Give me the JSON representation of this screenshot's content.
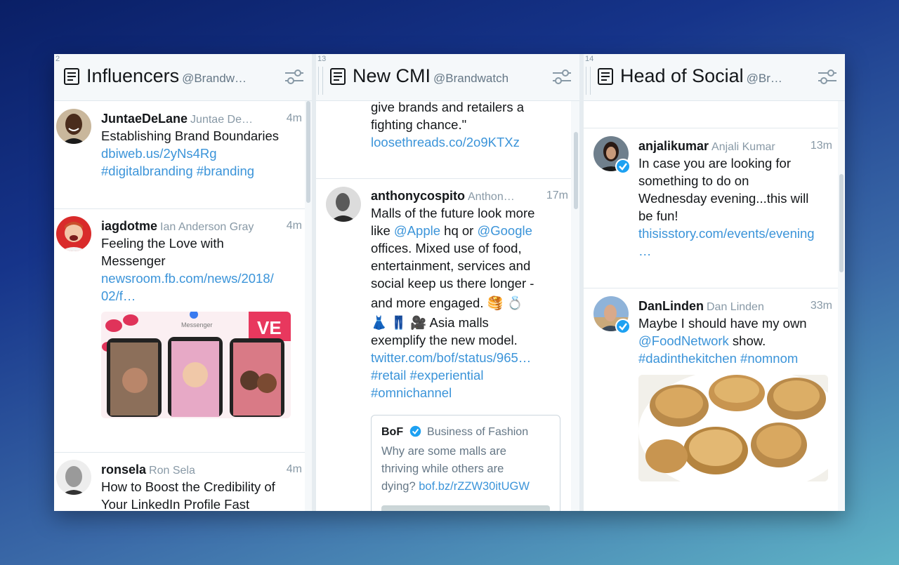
{
  "columns": [
    {
      "number": "2",
      "title": "Influencers",
      "subtitle": "@Brandw…",
      "tweets": [
        {
          "handle": "JuntaeDeLane",
          "fullname": "Juntae De…",
          "time": "4m",
          "text": "Establishing Brand Boundaries",
          "link": "dbiweb.us/2yNs4Rg",
          "tags": "#digitalbranding #branding"
        },
        {
          "handle": "iagdotme",
          "fullname": "Ian Anderson Gray",
          "time": "4m",
          "text_line1": "Feeling the Love with",
          "text_line2": "Messenger",
          "link_line1": "newsroom.fb.com/news/2018/",
          "link_line2": "02/f…",
          "media_caption": "Messenger",
          "media_badge": "VE"
        },
        {
          "handle": "ronsela",
          "fullname": "Ron Sela",
          "time": "4m",
          "text_line1": "How to Boost the Credibility of",
          "text_line2": "Your LinkedIn Profile Fast"
        }
      ]
    },
    {
      "number": "13",
      "title": "New CMI",
      "subtitle": "@Brandwatch",
      "partial": {
        "line1": "give brands and retailers a",
        "line2": "fighting chance.\"",
        "link": "loosethreads.co/2o9KTXz"
      },
      "tweets": [
        {
          "handle": "anthonycospito",
          "fullname": "Anthon…",
          "time": "17m",
          "l1": "Malls of the future look more",
          "l2_pre": "like ",
          "l2_m1": "@Apple",
          "l2_mid": " hq or ",
          "l2_m2": "@Google",
          "l3": "offices. Mixed use of food,",
          "l4": "entertainment, services and",
          "l5": "social keep us there longer -",
          "l6": "and more engaged. 🥞 💍",
          "l7": "👗 👖 🎥 Asia malls",
          "l8": "exemplify the new model.",
          "link": "twitter.com/bof/status/965…",
          "tags1": "#retail #experiential",
          "tags2": "#omnichannel",
          "quote": {
            "handle": "BoF",
            "fullname": "Business of Fashion",
            "line1": "Why are some malls are",
            "line2": "thriving while others are",
            "line3_pre": "dying? ",
            "line3_link": "bof.bz/rZZW30itUGW"
          }
        }
      ]
    },
    {
      "number": "14",
      "title": "Head of Social",
      "subtitle": "@Br…",
      "tweets": [
        {
          "handle": "anjalikumar",
          "fullname": "Anjali Kumar",
          "time": "13m",
          "l1": "In case you are looking for",
          "l2": "something to do on",
          "l3": "Wednesday evening...this will",
          "l4": "be fun!",
          "link1": "thisisstory.com/events/evening",
          "link2": "…"
        },
        {
          "handle": "DanLinden",
          "fullname": "Dan Linden",
          "time": "33m",
          "l1": "Maybe I should have my own",
          "mention": "@FoodNetwork",
          "l2_post": " show.",
          "tags": "#dadinthekitchen #nomnom"
        }
      ]
    }
  ],
  "colors": {
    "link": "#3b94d9",
    "verified": "#1da1f2",
    "header_bg": "#f5f8fa"
  },
  "icons": {
    "column_type": "list-icon",
    "filter": "filter-sliders-icon",
    "verified": "verified-badge-icon"
  }
}
